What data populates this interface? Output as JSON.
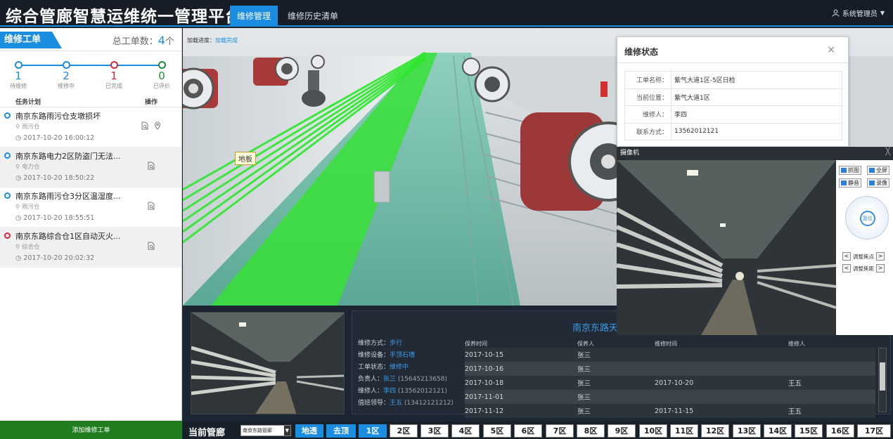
{
  "header": {
    "app_title": "综合管廊智慧运维统一管理平台",
    "tabs": [
      {
        "label": "维修管理",
        "active": true
      },
      {
        "label": "维修历史清单",
        "active": false
      }
    ],
    "user": {
      "name": "系统管理员",
      "icon": "user-icon",
      "dropdown_icon": "caret-down-icon"
    },
    "accent_color": "#1b8de0"
  },
  "sidebar": {
    "title": "维修工单",
    "total_label": "总工单数：",
    "total_count": "4",
    "total_unit": "个",
    "progress": [
      {
        "count": "1",
        "label": "待维修",
        "color": "#1b8de0"
      },
      {
        "count": "2",
        "label": "维修中",
        "color": "#1b8de0"
      },
      {
        "count": "1",
        "label": "已完成",
        "color": "#d4263c"
      },
      {
        "count": "0",
        "label": "已评价",
        "color": "#1f8a3a"
      }
    ],
    "columns": {
      "task": "任务计划",
      "ops": "操作"
    },
    "tasks": [
      {
        "name": "南京东路雨污仓支墩损坏",
        "location": "雨污仓",
        "time": "2017-10-20 16:00:12",
        "status_color": "#1b8de0"
      },
      {
        "name": "南京东路电力2区防盗门无法...",
        "location": "电力仓",
        "time": "2017-10-20 18:50:22",
        "status_color": "#1b8de0"
      },
      {
        "name": "南京东路雨污仓3分区温湿度...",
        "location": "雨污仓",
        "time": "2017-10-20 18:55:51",
        "status_color": "#1b8de0"
      },
      {
        "name": "南京东路综合仓1区自动灭火...",
        "location": "综合仓",
        "time": "2017-10-20 20:02:32",
        "status_color": "#d4263c"
      }
    ],
    "add_button": "添加维修工单"
  },
  "viewport": {
    "load_label": "加载进度：",
    "load_value": "加载完成",
    "floor_tag": "地板"
  },
  "status_popup": {
    "title": "维修状态",
    "close": "×",
    "rows": [
      {
        "key": "工单名称：",
        "value": "紫气大道1区-5区日检"
      },
      {
        "key": "当前位置：",
        "value": "紫气大道1区"
      },
      {
        "key": "维修人：",
        "value": "李四"
      },
      {
        "key": "联系方式：",
        "value": "13562012121"
      }
    ]
  },
  "camera_popup": {
    "title": "摄像机",
    "close": "╳",
    "buttons": {
      "snapshot": "抓图",
      "fullscreen": "全屏",
      "mute": "静音",
      "record": "录像"
    },
    "reset": "复位",
    "focus_label": "调整焦点",
    "focal_label": "调整焦距",
    "left_arrow": "<",
    "right_arrow": ">"
  },
  "detail": {
    "location_title": "南京东路天",
    "fields": [
      {
        "key": "维修方式：",
        "value": "步行",
        "extra": ""
      },
      {
        "key": "维修设备：",
        "value": "手顶石墙",
        "extra": ""
      },
      {
        "key": "工单状态：",
        "value": "维修中",
        "extra": ""
      },
      {
        "key": "负责人：",
        "value": "张三",
        "extra": " (15645213658)"
      },
      {
        "key": "维修人：",
        "value": "李四",
        "extra": " (13562012121)"
      },
      {
        "key": "值班领导：",
        "value": "王五",
        "extra": " (13412121212)"
      }
    ],
    "table": {
      "headers": [
        "保养时间",
        "保养人",
        "维修时间",
        "维修人"
      ],
      "rows": [
        [
          "2017-10-15",
          "张三",
          "",
          ""
        ],
        [
          "2017-10-16",
          "张三",
          "",
          ""
        ],
        [
          "2017-10-18",
          "张三",
          "2017-10-20",
          "王五"
        ],
        [
          "2017-11-01",
          "张三",
          "",
          ""
        ],
        [
          "2017-11-12",
          "张三",
          "2017-11-15",
          "王五"
        ]
      ]
    }
  },
  "bottom_bar": {
    "label": "当前管廊",
    "select_value": "南京东路管廊",
    "view_buttons": [
      "地透",
      "去顶"
    ],
    "zones": [
      "1区",
      "2区",
      "3区",
      "4区",
      "5区",
      "6区",
      "7区",
      "8区",
      "9区",
      "10区",
      "11区",
      "12区",
      "13区",
      "14区",
      "15区",
      "16区",
      "17区"
    ],
    "active_zone": "1区"
  }
}
